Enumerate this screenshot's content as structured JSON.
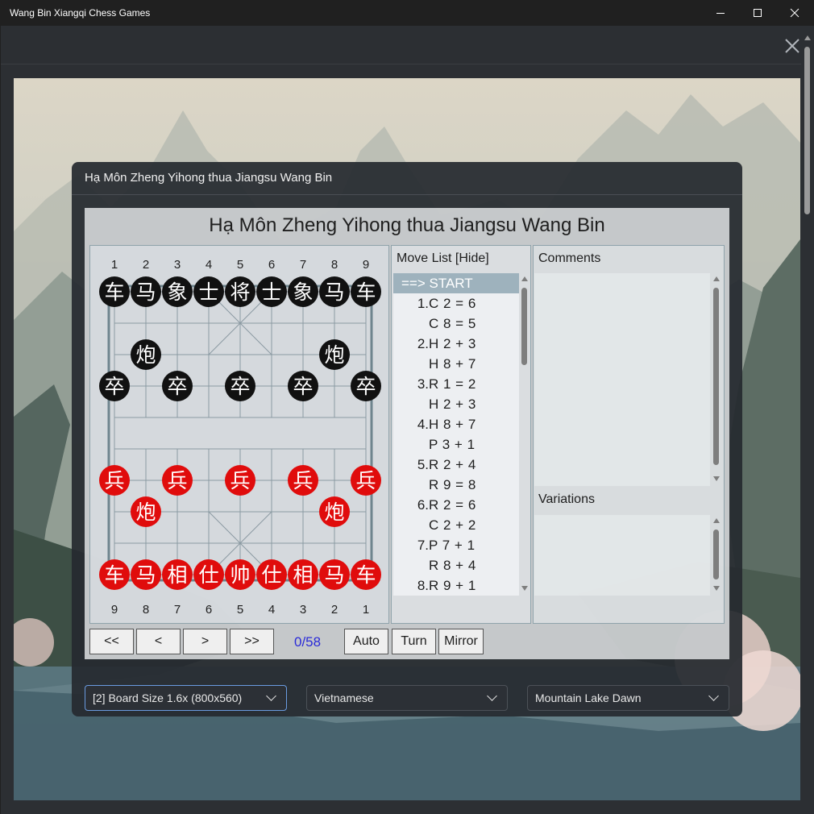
{
  "window": {
    "title": "Wang Bin Xiangqi Chess Games",
    "controls": [
      "minimize-icon",
      "maximize-icon",
      "close-icon"
    ]
  },
  "dialog": {
    "title": "Hạ Môn Zheng Yihong thua Jiangsu Wang Bin",
    "game_title": "Hạ Môn Zheng Yihong thua Jiangsu Wang Bin"
  },
  "board": {
    "top_files": [
      "1",
      "2",
      "3",
      "4",
      "5",
      "6",
      "7",
      "8",
      "9"
    ],
    "bottom_files": [
      "9",
      "8",
      "7",
      "6",
      "5",
      "4",
      "3",
      "2",
      "1"
    ],
    "pieces": [
      {
        "char": "车",
        "side": "black",
        "file": 0,
        "rank": 0
      },
      {
        "char": "马",
        "side": "black",
        "file": 1,
        "rank": 0
      },
      {
        "char": "象",
        "side": "black",
        "file": 2,
        "rank": 0
      },
      {
        "char": "士",
        "side": "black",
        "file": 3,
        "rank": 0
      },
      {
        "char": "将",
        "side": "black",
        "file": 4,
        "rank": 0
      },
      {
        "char": "士",
        "side": "black",
        "file": 5,
        "rank": 0
      },
      {
        "char": "象",
        "side": "black",
        "file": 6,
        "rank": 0
      },
      {
        "char": "马",
        "side": "black",
        "file": 7,
        "rank": 0
      },
      {
        "char": "车",
        "side": "black",
        "file": 8,
        "rank": 0
      },
      {
        "char": "炮",
        "side": "black",
        "file": 1,
        "rank": 2
      },
      {
        "char": "炮",
        "side": "black",
        "file": 7,
        "rank": 2
      },
      {
        "char": "卒",
        "side": "black",
        "file": 0,
        "rank": 3
      },
      {
        "char": "卒",
        "side": "black",
        "file": 2,
        "rank": 3
      },
      {
        "char": "卒",
        "side": "black",
        "file": 4,
        "rank": 3
      },
      {
        "char": "卒",
        "side": "black",
        "file": 6,
        "rank": 3
      },
      {
        "char": "卒",
        "side": "black",
        "file": 8,
        "rank": 3
      },
      {
        "char": "兵",
        "side": "red",
        "file": 0,
        "rank": 6
      },
      {
        "char": "兵",
        "side": "red",
        "file": 2,
        "rank": 6
      },
      {
        "char": "兵",
        "side": "red",
        "file": 4,
        "rank": 6
      },
      {
        "char": "兵",
        "side": "red",
        "file": 6,
        "rank": 6
      },
      {
        "char": "兵",
        "side": "red",
        "file": 8,
        "rank": 6
      },
      {
        "char": "炮",
        "side": "red",
        "file": 1,
        "rank": 7
      },
      {
        "char": "炮",
        "side": "red",
        "file": 7,
        "rank": 7
      },
      {
        "char": "车",
        "side": "red",
        "file": 0,
        "rank": 9
      },
      {
        "char": "马",
        "side": "red",
        "file": 1,
        "rank": 9
      },
      {
        "char": "相",
        "side": "red",
        "file": 2,
        "rank": 9
      },
      {
        "char": "仕",
        "side": "red",
        "file": 3,
        "rank": 9
      },
      {
        "char": "帅",
        "side": "red",
        "file": 4,
        "rank": 9
      },
      {
        "char": "仕",
        "side": "red",
        "file": 5,
        "rank": 9
      },
      {
        "char": "相",
        "side": "red",
        "file": 6,
        "rank": 9
      },
      {
        "char": "马",
        "side": "red",
        "file": 7,
        "rank": 9
      },
      {
        "char": "车",
        "side": "red",
        "file": 8,
        "rank": 9
      }
    ],
    "colors": {
      "red": "#e00c0c",
      "black": "#111111"
    }
  },
  "move_list": {
    "header": "Move List [Hide]",
    "rows": [
      {
        "num": "",
        "move": "==> START",
        "current": true
      },
      {
        "num": "1.",
        "move": "C 2 = 6"
      },
      {
        "num": "",
        "move": "C 8 = 5"
      },
      {
        "num": "2.",
        "move": "H 2 + 3"
      },
      {
        "num": "",
        "move": "H 8 + 7"
      },
      {
        "num": "3.",
        "move": "R 1 = 2"
      },
      {
        "num": "",
        "move": "H 2 + 3"
      },
      {
        "num": "4.",
        "move": "H 8 + 7"
      },
      {
        "num": "",
        "move": "P 3 + 1"
      },
      {
        "num": "5.",
        "move": "R 2 + 4"
      },
      {
        "num": "",
        "move": "R 9 = 8"
      },
      {
        "num": "6.",
        "move": "R 2 = 6"
      },
      {
        "num": "",
        "move": "C 2 + 2"
      },
      {
        "num": "7.",
        "move": "P 7 + 1"
      },
      {
        "num": "",
        "move": "R 8 + 4"
      },
      {
        "num": "8.",
        "move": "R 9 + 1"
      }
    ]
  },
  "comments": {
    "header": "Comments"
  },
  "variations": {
    "header": "Variations"
  },
  "nav": {
    "first": "<<",
    "prev": "<",
    "next": ">",
    "last": ">>",
    "counter": "0/58",
    "auto": "Auto",
    "turn": "Turn",
    "mirror": "Mirror"
  },
  "selects": {
    "board_size": "[2] Board Size 1.6x (800x560)",
    "language": "Vietnamese",
    "theme": "Mountain Lake Dawn"
  }
}
